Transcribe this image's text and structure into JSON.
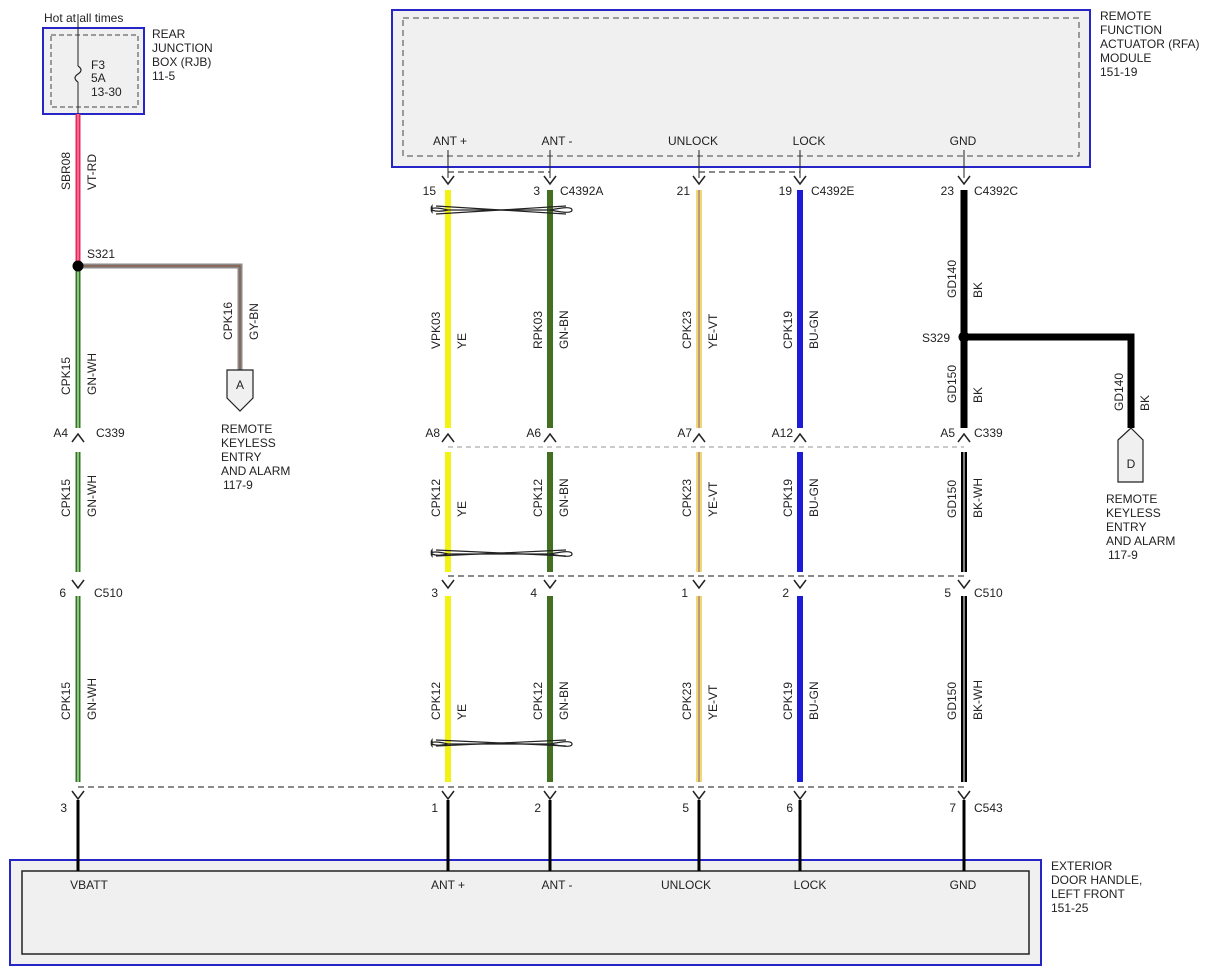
{
  "colors": {
    "module_border": "#2525c8",
    "module_fill": "#f0f0f0",
    "dash": "#444444",
    "GN-WH": "#2e7a1e",
    "GY-BN": "#9a9a9a",
    "VT-RD": "#e8285a",
    "YE": "#f2f214",
    "GN-BN": "#2e7a1e",
    "YE-VT": "#f0d874",
    "BU-GN": "#1c1cd8",
    "BK": "#000000",
    "BK-WH": "#000000"
  },
  "top_label": "Hot at all times",
  "rjb": {
    "fuse_name": "F3",
    "fuse_rating": "5A",
    "fuse_ref": "13-30",
    "title": [
      "REAR",
      "JUNCTION",
      "BOX (RJB)",
      "11-5"
    ]
  },
  "rfa": {
    "title": [
      "REMOTE",
      "FUNCTION",
      "ACTUATOR (RFA)",
      "MODULE",
      "151-19"
    ],
    "pins": [
      "ANT +",
      "ANT -",
      "UNLOCK",
      "LOCK",
      "GND"
    ]
  },
  "door": {
    "title": [
      "EXTERIOR",
      "DOOR HANDLE,",
      "LEFT FRONT",
      "151-25"
    ],
    "pins": [
      "VBATT",
      "ANT +",
      "ANT -",
      "UNLOCK",
      "LOCK",
      "GND"
    ]
  },
  "rfa_connectors": [
    {
      "pin": "15",
      "name": ""
    },
    {
      "pin": "3",
      "name": "C4392A"
    },
    {
      "pin": "21",
      "name": ""
    },
    {
      "pin": "19",
      "name": "C4392E"
    },
    {
      "pin": "23",
      "name": "C4392C"
    }
  ],
  "c339": {
    "name": "C339",
    "pins": [
      "A4",
      "A8",
      "A6",
      "A7",
      "A12",
      "A5"
    ]
  },
  "c510": {
    "name": "C510",
    "pins": [
      "6",
      "3",
      "4",
      "1",
      "2",
      "5"
    ]
  },
  "c543": {
    "name": "C543",
    "pins": [
      "3",
      "1",
      "2",
      "5",
      "6",
      "7"
    ]
  },
  "splices": {
    "s321": "S321",
    "s329": "S329"
  },
  "wires": {
    "sbr08": {
      "circuit": "SBR08",
      "color": "VT-RD"
    },
    "cpk16": {
      "circuit": "CPK16",
      "color": "GY-BN"
    },
    "vbatt": [
      {
        "circuit": "CPK15",
        "color": "GN-WH"
      },
      {
        "circuit": "CPK15",
        "color": "GN-WH"
      },
      {
        "circuit": "CPK15",
        "color": "GN-WH"
      }
    ],
    "ant_plus": [
      {
        "circuit": "VPK03",
        "color": "YE"
      },
      {
        "circuit": "CPK12",
        "color": "YE"
      },
      {
        "circuit": "CPK12",
        "color": "YE"
      }
    ],
    "ant_minus": [
      {
        "circuit": "RPK03",
        "color": "GN-BN"
      },
      {
        "circuit": "CPK12",
        "color": "GN-BN"
      },
      {
        "circuit": "CPK12",
        "color": "GN-BN"
      }
    ],
    "unlock": [
      {
        "circuit": "CPK23",
        "color": "YE-VT"
      },
      {
        "circuit": "CPK23",
        "color": "YE-VT"
      },
      {
        "circuit": "CPK23",
        "color": "YE-VT"
      }
    ],
    "lock": [
      {
        "circuit": "CPK19",
        "color": "BU-GN"
      },
      {
        "circuit": "CPK19",
        "color": "BU-GN"
      },
      {
        "circuit": "CPK19",
        "color": "BU-GN"
      }
    ],
    "gnd": [
      {
        "circuit": "GD140",
        "color": "BK"
      },
      {
        "circuit": "GD150",
        "color": "BK"
      },
      {
        "circuit": "GD150",
        "color": "BK-WH"
      },
      {
        "circuit": "GD150",
        "color": "BK-WH"
      }
    ],
    "gd140_branch": {
      "circuit": "GD140",
      "color": "BK"
    }
  },
  "ref_a": {
    "letter": "A",
    "title": [
      "REMOTE",
      "KEYLESS",
      "ENTRY",
      "AND ALARM",
      "117-9"
    ]
  },
  "ref_d": {
    "letter": "D",
    "title": [
      "REMOTE",
      "KEYLESS",
      "ENTRY",
      "AND ALARM",
      "117-9"
    ]
  }
}
